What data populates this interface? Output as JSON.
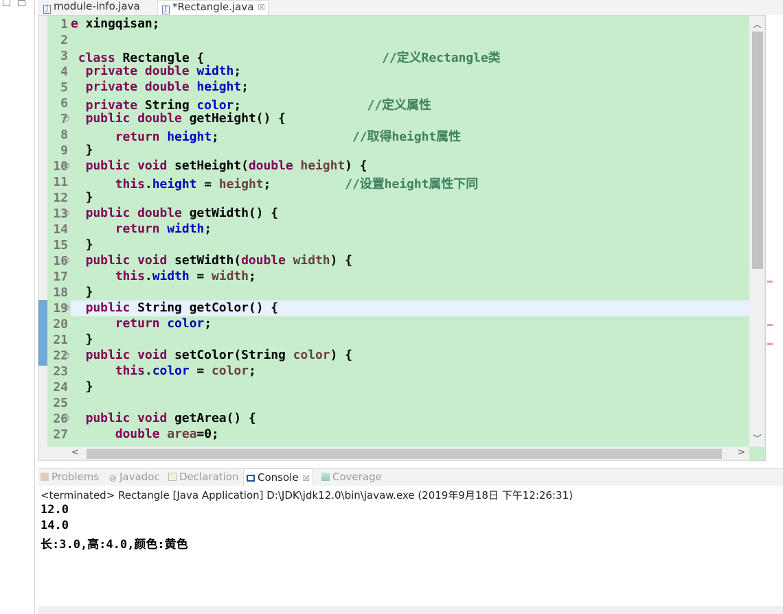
{
  "tabs": [
    {
      "label": "module-info.java",
      "active": false
    },
    {
      "label": "*Rectangle.java",
      "active": true,
      "close": "☒"
    }
  ],
  "editor": {
    "current_line": 19,
    "lines": [
      {
        "n": "1",
        "tokens": [
          [
            "k",
            "e"
          ],
          [
            "t",
            " xingqisan;"
          ]
        ]
      },
      {
        "n": "2",
        "tokens": []
      },
      {
        "n": "3",
        "tokens": [
          [
            "t",
            " "
          ],
          [
            "k",
            "class"
          ],
          [
            "t",
            " Rectangle {                        "
          ],
          [
            "c",
            "//定义Rectangle类"
          ]
        ]
      },
      {
        "n": "4",
        "tokens": [
          [
            "t",
            "  "
          ],
          [
            "k",
            "private double"
          ],
          [
            "t",
            " "
          ],
          [
            "f",
            "width"
          ],
          [
            "t",
            ";"
          ]
        ]
      },
      {
        "n": "5",
        "tokens": [
          [
            "t",
            "  "
          ],
          [
            "k",
            "private double"
          ],
          [
            "t",
            " "
          ],
          [
            "f",
            "height"
          ],
          [
            "t",
            ";"
          ]
        ]
      },
      {
        "n": "6",
        "tokens": [
          [
            "t",
            "  "
          ],
          [
            "k",
            "private"
          ],
          [
            "t",
            " String "
          ],
          [
            "f",
            "color"
          ],
          [
            "t",
            ";                 "
          ],
          [
            "c",
            "//定义属性"
          ]
        ]
      },
      {
        "n": "7",
        "fold": true,
        "tokens": [
          [
            "t",
            "  "
          ],
          [
            "k",
            "public double"
          ],
          [
            "t",
            " getHeight() {"
          ]
        ]
      },
      {
        "n": "8",
        "tokens": [
          [
            "t",
            "      "
          ],
          [
            "k",
            "return"
          ],
          [
            "t",
            " "
          ],
          [
            "f",
            "height"
          ],
          [
            "t",
            ";                  "
          ],
          [
            "c",
            "//取得height属性"
          ]
        ]
      },
      {
        "n": "9",
        "tokens": [
          [
            "t",
            "  }"
          ]
        ]
      },
      {
        "n": "10",
        "fold": true,
        "tokens": [
          [
            "t",
            "  "
          ],
          [
            "k",
            "public void"
          ],
          [
            "t",
            " setHeight("
          ],
          [
            "k",
            "double"
          ],
          [
            "t",
            " "
          ],
          [
            "p",
            "height"
          ],
          [
            "t",
            ") {"
          ]
        ]
      },
      {
        "n": "11",
        "tokens": [
          [
            "t",
            "      "
          ],
          [
            "k",
            "this"
          ],
          [
            "t",
            "."
          ],
          [
            "f",
            "height"
          ],
          [
            "t",
            " = "
          ],
          [
            "p",
            "height"
          ],
          [
            "t",
            ";          "
          ],
          [
            "c",
            "//设置height属性下同"
          ]
        ]
      },
      {
        "n": "12",
        "tokens": [
          [
            "t",
            "  }"
          ]
        ]
      },
      {
        "n": "13",
        "fold": true,
        "tokens": [
          [
            "t",
            "  "
          ],
          [
            "k",
            "public double"
          ],
          [
            "t",
            " getWidth() {"
          ]
        ]
      },
      {
        "n": "14",
        "tokens": [
          [
            "t",
            "      "
          ],
          [
            "k",
            "return"
          ],
          [
            "t",
            " "
          ],
          [
            "f",
            "width"
          ],
          [
            "t",
            ";"
          ]
        ]
      },
      {
        "n": "15",
        "tokens": [
          [
            "t",
            "  }"
          ]
        ]
      },
      {
        "n": "16",
        "fold": true,
        "tokens": [
          [
            "t",
            "  "
          ],
          [
            "k",
            "public void"
          ],
          [
            "t",
            " setWidth("
          ],
          [
            "k",
            "double"
          ],
          [
            "t",
            " "
          ],
          [
            "p",
            "width"
          ],
          [
            "t",
            ") {"
          ]
        ]
      },
      {
        "n": "17",
        "tokens": [
          [
            "t",
            "      "
          ],
          [
            "k",
            "this"
          ],
          [
            "t",
            "."
          ],
          [
            "f",
            "width"
          ],
          [
            "t",
            " = "
          ],
          [
            "p",
            "width"
          ],
          [
            "t",
            ";"
          ]
        ]
      },
      {
        "n": "18",
        "tokens": [
          [
            "t",
            "  }"
          ]
        ]
      },
      {
        "n": "19",
        "fold": true,
        "tokens": [
          [
            "t",
            "  "
          ],
          [
            "k",
            "public"
          ],
          [
            "t",
            " String getColor() {"
          ]
        ]
      },
      {
        "n": "20",
        "tokens": [
          [
            "t",
            "      "
          ],
          [
            "k",
            "return"
          ],
          [
            "t",
            " "
          ],
          [
            "f",
            "color"
          ],
          [
            "t",
            ";"
          ]
        ]
      },
      {
        "n": "21",
        "tokens": [
          [
            "t",
            "  }"
          ]
        ]
      },
      {
        "n": "22",
        "fold": true,
        "tokens": [
          [
            "t",
            "  "
          ],
          [
            "k",
            "public void"
          ],
          [
            "t",
            " setColor(String "
          ],
          [
            "p",
            "color"
          ],
          [
            "t",
            ") {"
          ]
        ]
      },
      {
        "n": "23",
        "tokens": [
          [
            "t",
            "      "
          ],
          [
            "k",
            "this"
          ],
          [
            "t",
            "."
          ],
          [
            "f",
            "color"
          ],
          [
            "t",
            " = "
          ],
          [
            "p",
            "color"
          ],
          [
            "t",
            ";"
          ]
        ]
      },
      {
        "n": "24",
        "tokens": [
          [
            "t",
            "  }"
          ]
        ]
      },
      {
        "n": "25",
        "tokens": []
      },
      {
        "n": "26",
        "fold": true,
        "tokens": [
          [
            "t",
            "  "
          ],
          [
            "k",
            "public void"
          ],
          [
            "t",
            " getArea() {"
          ]
        ]
      },
      {
        "n": "27",
        "tokens": [
          [
            "t",
            "      "
          ],
          [
            "k",
            "double"
          ],
          [
            "t",
            " "
          ],
          [
            "p",
            "area"
          ],
          [
            "t",
            "=0;"
          ]
        ]
      }
    ]
  },
  "panel": {
    "tabs": [
      {
        "label": "Problems"
      },
      {
        "label": "Javadoc"
      },
      {
        "label": "Declaration"
      },
      {
        "label": "Console",
        "active": true,
        "close": "☒"
      },
      {
        "label": "Coverage"
      }
    ],
    "status": "<terminated> Rectangle [Java Application] D:\\JDK\\jdk12.0\\bin\\javaw.exe (2019年9月18日 下午12:26:31)",
    "output": [
      "12.0",
      "14.0",
      "长:3.0,高:4.0,颜色:黄色"
    ]
  }
}
